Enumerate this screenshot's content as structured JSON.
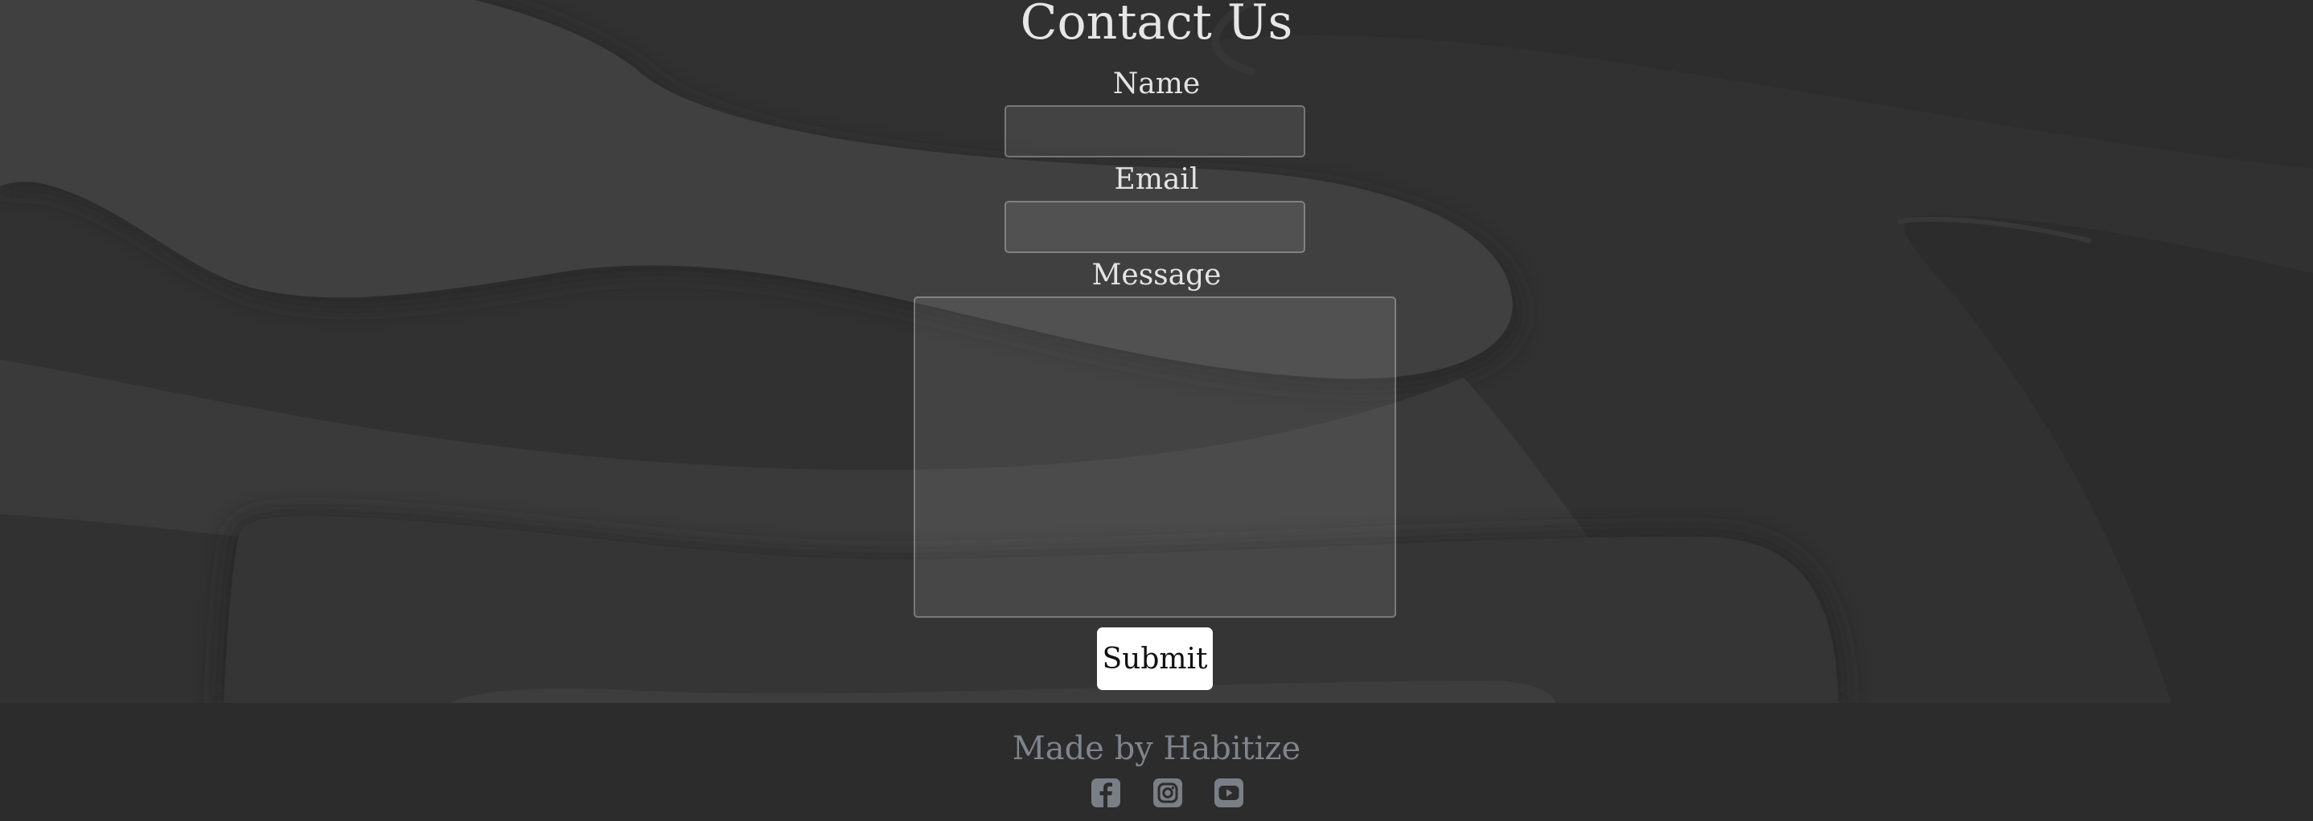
{
  "contact": {
    "title": "Contact Us",
    "name_label": "Name",
    "email_label": "Email",
    "message_label": "Message",
    "name_value": "",
    "email_value": "",
    "message_value": "",
    "submit_label": "Submit"
  },
  "footer": {
    "credit": "Made by Habitize",
    "social": [
      "facebook-icon",
      "instagram-icon",
      "youtube-icon"
    ]
  },
  "colors": {
    "background": "#2c2c2c",
    "title_text": "#e6e6e6",
    "footer_text": "#7f858c",
    "submit_bg": "#ffffff",
    "icon": "#7a7f86"
  }
}
